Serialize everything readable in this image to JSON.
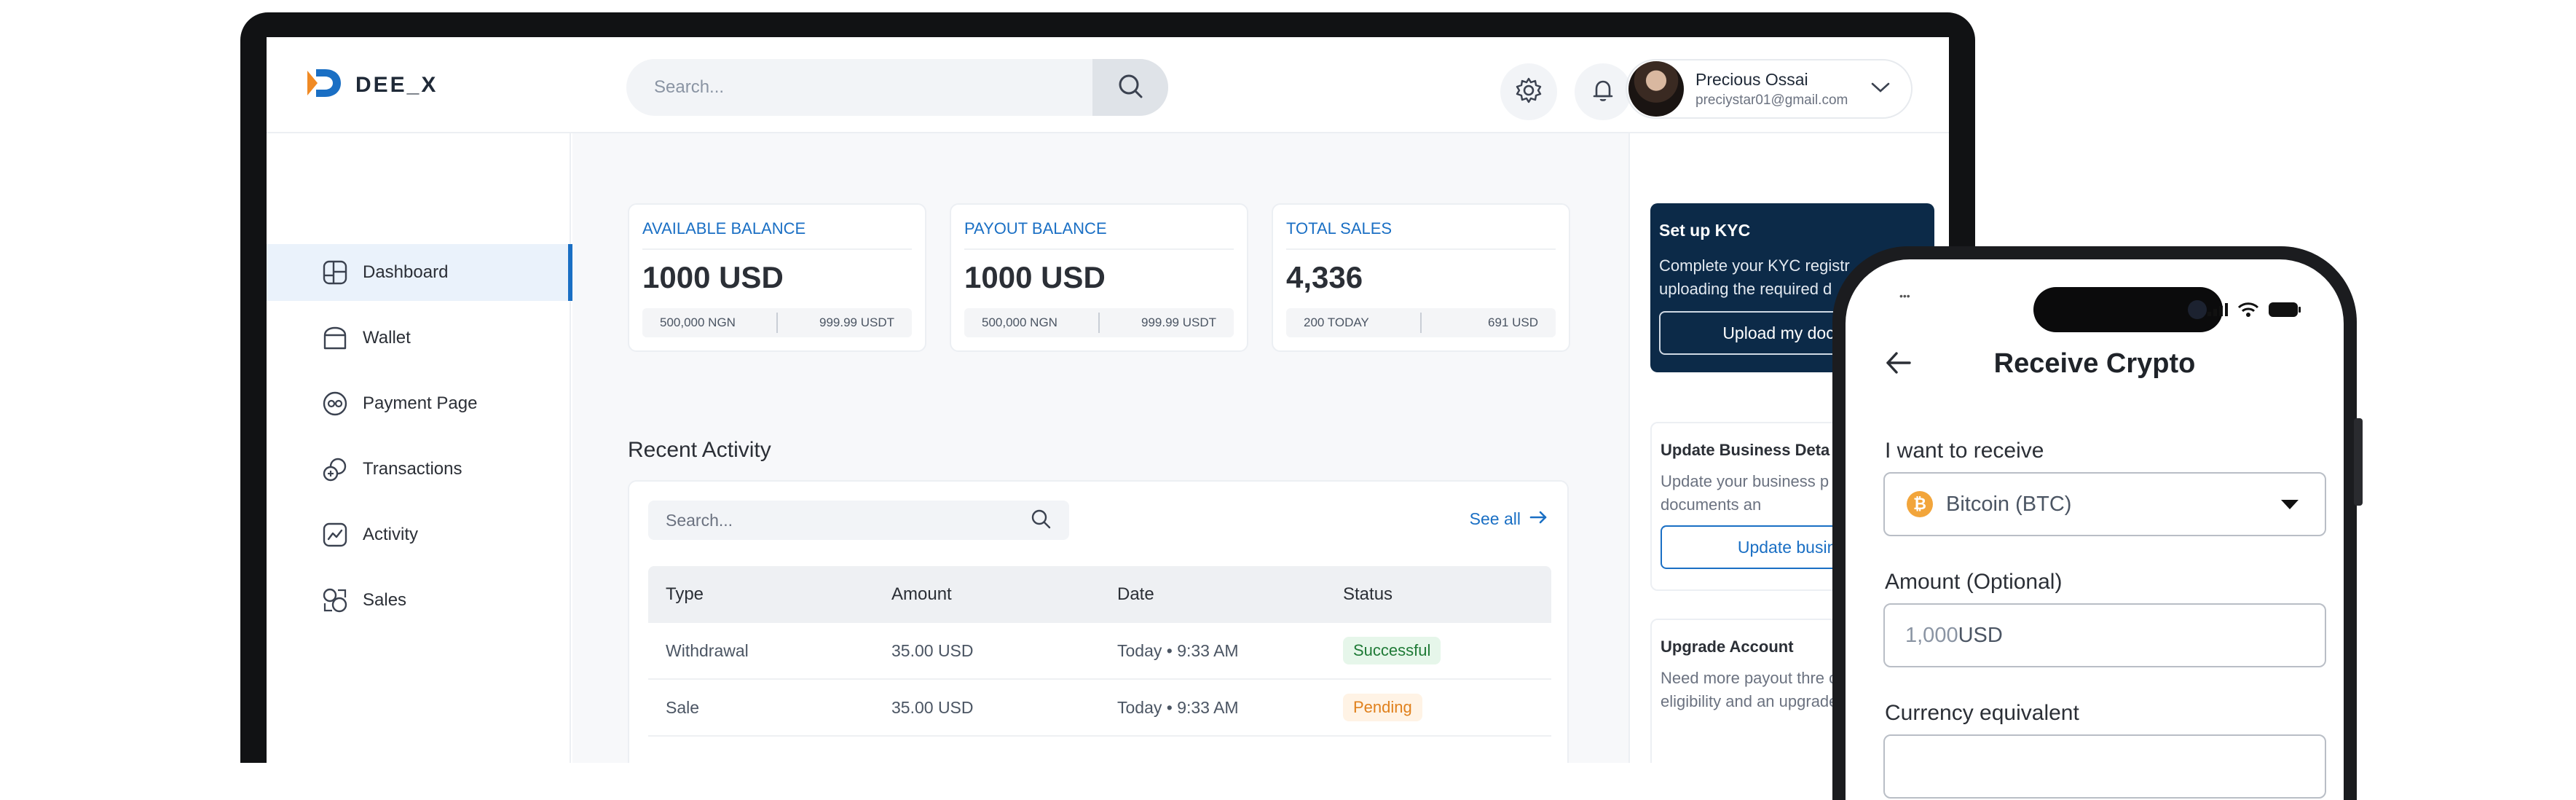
{
  "app": {
    "logo_text": "DEE_X"
  },
  "header": {
    "search_placeholder": "Search...",
    "user_name": "Precious Ossai",
    "user_email": "preciystar01@gmail.com"
  },
  "sidebar": {
    "items": [
      {
        "label": "Dashboard",
        "icon": "dashboard-icon",
        "active": true
      },
      {
        "label": "Wallet",
        "icon": "wallet-icon"
      },
      {
        "label": "Payment Page",
        "icon": "payment-page-icon"
      },
      {
        "label": "Transactions",
        "icon": "transactions-icon"
      },
      {
        "label": "Activity",
        "icon": "activity-icon"
      },
      {
        "label": "Sales",
        "icon": "sales-icon"
      }
    ]
  },
  "cards": [
    {
      "title": "AVAILABLE BALANCE",
      "value": "1000 USD",
      "left": "500,000 NGN",
      "right": "999.99 USDT"
    },
    {
      "title": "PAYOUT BALANCE",
      "value": "1000 USD",
      "left": "500,000 NGN",
      "right": "999.99 USDT"
    },
    {
      "title": "TOTAL SALES",
      "value": "4,336",
      "left": "200  TODAY",
      "right": "691 USD"
    }
  ],
  "activity": {
    "title": "Recent Activity",
    "search_placeholder": "Search...",
    "see_all": "See all",
    "columns": [
      "Type",
      "Amount",
      "Date",
      "Status"
    ],
    "rows": [
      {
        "type": "Withdrawal",
        "amount": "35.00 USD",
        "date": "Today • 9:33 AM",
        "status": "Successful"
      },
      {
        "type": "Sale",
        "amount": "35.00 USD",
        "date": "Today • 9:33 AM",
        "status": "Pending"
      }
    ]
  },
  "right_panel": {
    "kyc": {
      "title": "Set up KYC",
      "desc": "Complete your KYC registr uploading the required d",
      "button": "Upload my docum"
    },
    "business": {
      "title": "Update Business Deta",
      "desc": "Update your business p identity, documents an",
      "button": "Update busine"
    },
    "upgrade": {
      "title": "Upgrade Account",
      "desc": "Need more payout thre check for eligibility and an upgrade"
    }
  },
  "phone": {
    "status_left": "•••",
    "title": "Receive Crypto",
    "receive_label": "I want to receive",
    "receive_value": "Bitcoin (BTC)",
    "amount_label": "Amount (Optional)",
    "amount_value": "1,000",
    "amount_unit": " USD",
    "currency_label": "Currency equivalent"
  },
  "colors": {
    "accent": "#1a6fc4",
    "navy": "#0c2a48",
    "success": "#1f7a36",
    "pending": "#e0801c",
    "btc": "#f2a53b"
  }
}
